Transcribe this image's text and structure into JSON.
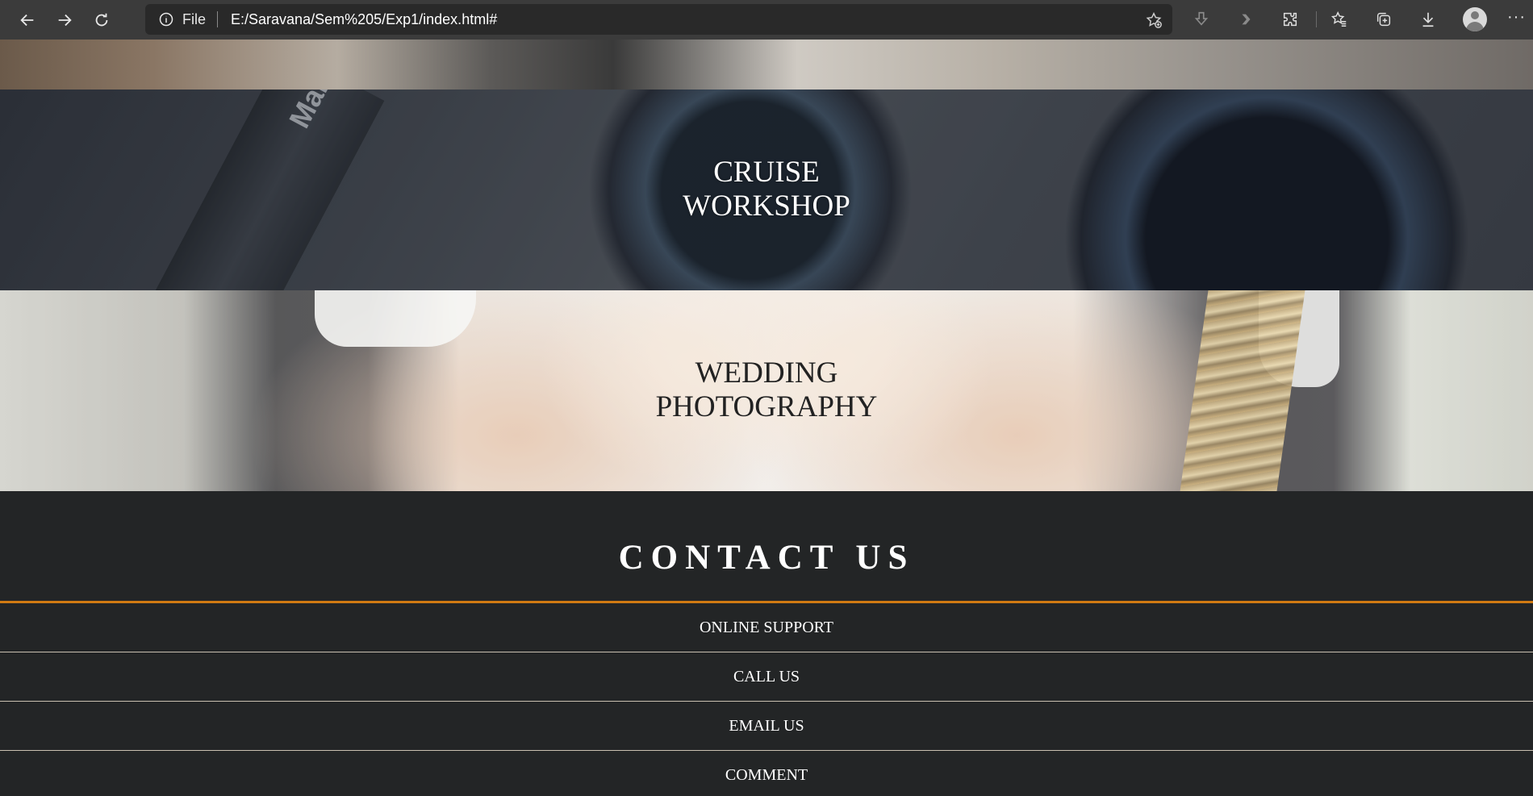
{
  "browser": {
    "protocol_label": "File",
    "url": "E:/Saravana/Sem%205/Exp1/index.html#",
    "icons": [
      "back-icon",
      "forward-icon",
      "refresh-icon",
      "info-icon",
      "favorite-add-icon",
      "download-arrow-icon",
      "chevron-right-icon",
      "extensions-icon",
      "favorites-icon",
      "collections-icon",
      "downloads-icon",
      "profile-icon",
      "more-icon"
    ],
    "more_label": "···"
  },
  "sections": {
    "cruise": {
      "title_line1": "CRUISE",
      "title_line2": "WORKSHOP",
      "watermark": "Manfro"
    },
    "wedding": {
      "title_line1": "WEDDING",
      "title_line2": "PHOTOGRAPHY"
    }
  },
  "contact": {
    "title": "CONTACT US",
    "accent_color": "#d07a12",
    "items": [
      {
        "label": "ONLINE SUPPORT"
      },
      {
        "label": "CALL US"
      },
      {
        "label": "EMAIL US"
      },
      {
        "label": "COMMENT"
      }
    ]
  }
}
